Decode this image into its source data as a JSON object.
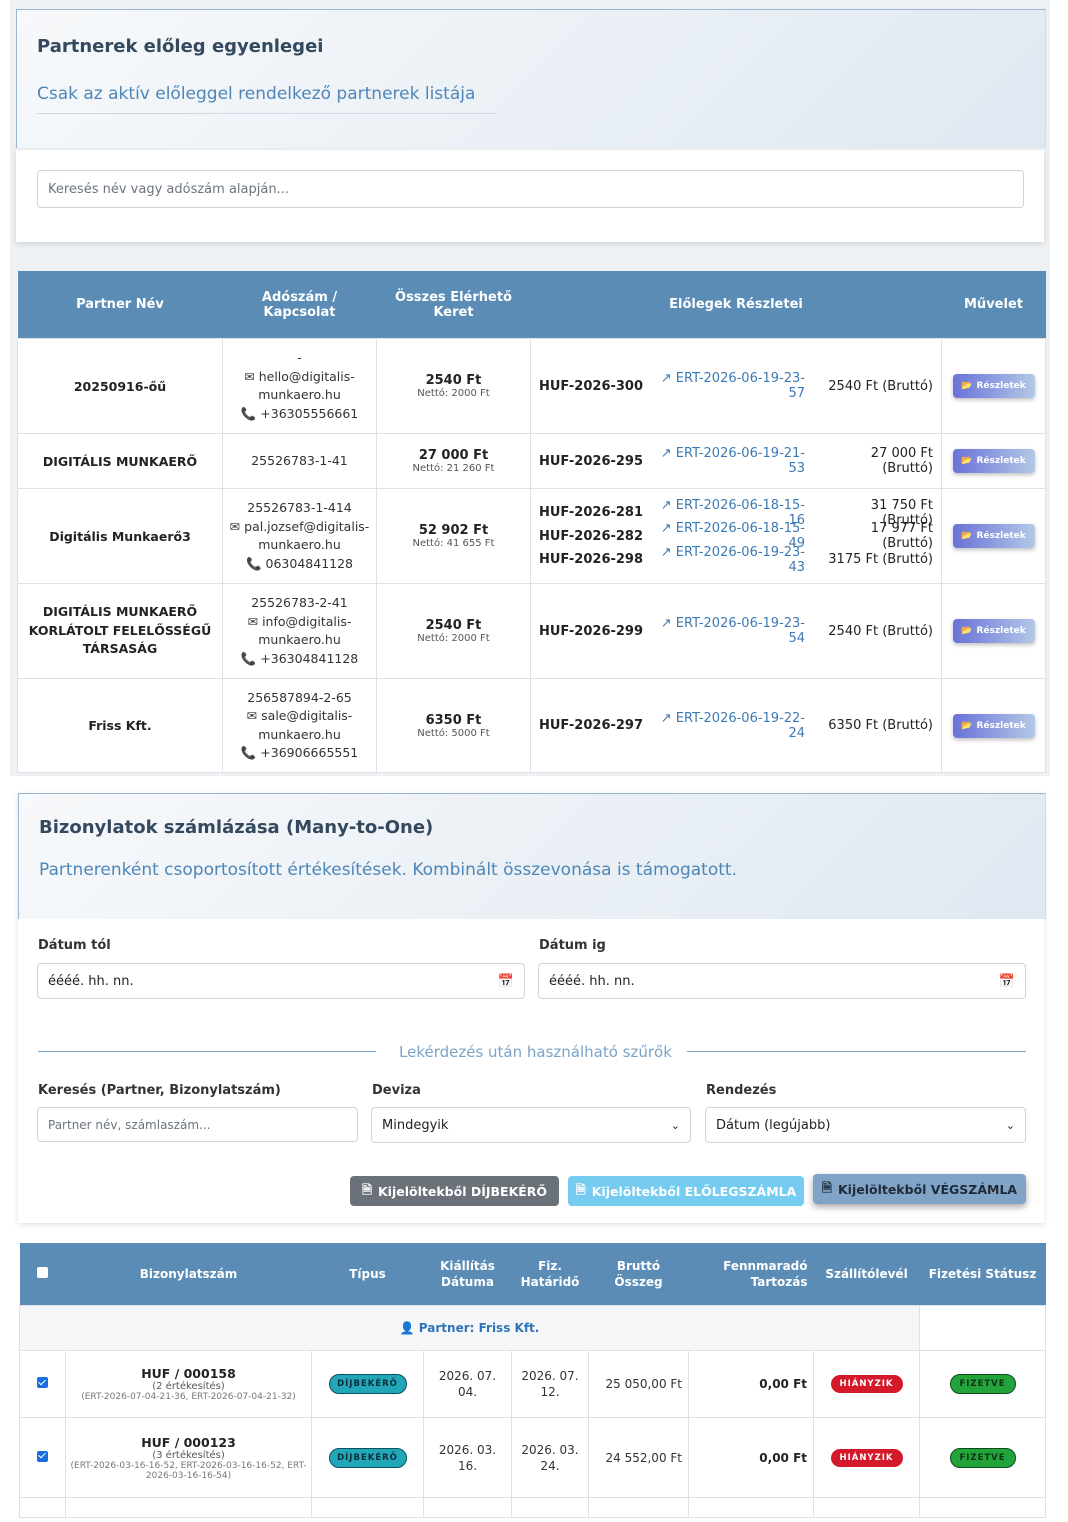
{
  "balances": {
    "title": "Partnerek előleg egyenlegei",
    "subtitle": "Csak az aktív előleggel rendelkező partnerek listája",
    "search_placeholder": "Keresés név vagy adószám alapján...",
    "columns": [
      "Partner Név",
      "Adószám / Kapcsolat",
      "Összes Elérhető Keret",
      "Előlegek Részletei",
      "Művelet"
    ],
    "action_label": "Részletek",
    "rows": [
      {
        "name": "20250916-őű",
        "contact": [
          "-",
          "hello@digitalis-",
          "munkaero.hu",
          "+36305556661"
        ],
        "total": "2540 Ft",
        "net": "Nettó: 2000 Ft",
        "details": [
          {
            "code": "HUF-2026-300",
            "link": "ERT-2026-06-19-23-57",
            "brutto": "2540 Ft (Bruttó)"
          }
        ]
      },
      {
        "name": "DIGITÁLIS MUNKAERŐ",
        "contact": [
          "25526783-1-41"
        ],
        "total": "27 000 Ft",
        "net": "Nettó: 21 260 Ft",
        "details": [
          {
            "code": "HUF-2026-295",
            "link": "ERT-2026-06-19-21-53",
            "brutto": "27 000 Ft (Bruttó)"
          }
        ]
      },
      {
        "name": "Digitális Munkaerő3",
        "contact": [
          "25526783-1-414",
          "pal.jozsef@digitalis-",
          "munkaero.hu",
          "06304841128"
        ],
        "total": "52 902 Ft",
        "net": "Nettó: 41 655 Ft",
        "details": [
          {
            "code": "HUF-2026-281",
            "link": "ERT-2026-06-18-15-16",
            "brutto": "31 750 Ft (Bruttó)"
          },
          {
            "code": "HUF-2026-282",
            "link": "ERT-2026-06-18-15-49",
            "brutto": "17 977 Ft (Bruttó)"
          },
          {
            "code": "HUF-2026-298",
            "link": "ERT-2026-06-19-23-43",
            "brutto": "3175 Ft (Bruttó)"
          }
        ]
      },
      {
        "name": "DIGITÁLIS MUNKAERŐ KORLÁTOLT FELELŐSSÉGŰ TÁRSASÁG",
        "contact": [
          "25526783-2-41",
          "info@digitalis-",
          "munkaero.hu",
          "+36304841128"
        ],
        "total": "2540 Ft",
        "net": "Nettó: 2000 Ft",
        "details": [
          {
            "code": "HUF-2026-299",
            "link": "ERT-2026-06-19-23-54",
            "brutto": "2540 Ft (Bruttó)"
          }
        ]
      },
      {
        "name": "Friss Kft.",
        "contact": [
          "256587894-2-65",
          "sale@digitalis-",
          "munkaero.hu",
          "+36906665551"
        ],
        "total": "6350 Ft",
        "net": "Nettó: 5000 Ft",
        "details": [
          {
            "code": "HUF-2026-297",
            "link": "ERT-2026-06-19-22-24",
            "brutto": "6350 Ft (Bruttó)"
          }
        ]
      }
    ]
  },
  "invoicing": {
    "title": "Bizonylatok számlázása (Many-to-One)",
    "subtitle": "Partnerenként csoportosított értékesítések. Kombinált összevonása is támogatott.",
    "date_from_label": "Dátum tól",
    "date_to_label": "Dátum ig",
    "date_placeholder": "éééé. hh. nn.",
    "filters_divider": "Lekérdezés után használható szűrők",
    "search_label": "Keresés (Partner, Bizonylatszám)",
    "search_placeholder": "Partner név, számlaszám...",
    "currency_label": "Deviza",
    "currency_value": "Mindegyik",
    "sort_label": "Rendezés",
    "sort_value": "Dátum (legújabb)",
    "btn_dijbekero": "Kijelöltekből DÍJBEKÉRŐ",
    "btn_eloleg": "Kijelöltekből ELŐLEGSZÁMLA",
    "btn_veg": "Kijelöltekből VÉGSZÁMLA",
    "columns": [
      "Bizonylatszám",
      "Típus",
      "Kiállítás Dátuma",
      "Fiz. Határidő",
      "Bruttó Összeg",
      "Fennmaradó Tartozás",
      "Szállítólevél",
      "Fizetési Státusz"
    ],
    "group_label": "Partner: Friss Kft.",
    "rows": [
      {
        "number": "HUF / 000158",
        "count": "(2 értékesítés)",
        "refs": [
          "(ERT-2026-07-04-21-36, ERT-2026-07-04-21-32)"
        ],
        "type": "DÍJBEKÉRŐ",
        "issued": [
          "2026. 07.",
          "04."
        ],
        "due": [
          "2026. 07.",
          "12."
        ],
        "gross": "25 050,00 Ft",
        "remaining": "0,00 Ft",
        "delivery": "HIÁNYZIK",
        "status": "FIZETVE"
      },
      {
        "number": "HUF / 000123",
        "count": "(3 értékesítés)",
        "refs": [
          "(ERT-2026-03-16-16-52, ERT-2026-03-16-16-52, ERT-",
          "2026-03-16-16-54)"
        ],
        "type": "DÍJBEKÉRŐ",
        "issued": [
          "2026. 03.",
          "16."
        ],
        "due": [
          "2026. 03.",
          "24."
        ],
        "gross": "24 552,00 Ft",
        "remaining": "0,00 Ft",
        "delivery": "HIÁNYZIK",
        "status": "FIZETVE"
      }
    ]
  }
}
